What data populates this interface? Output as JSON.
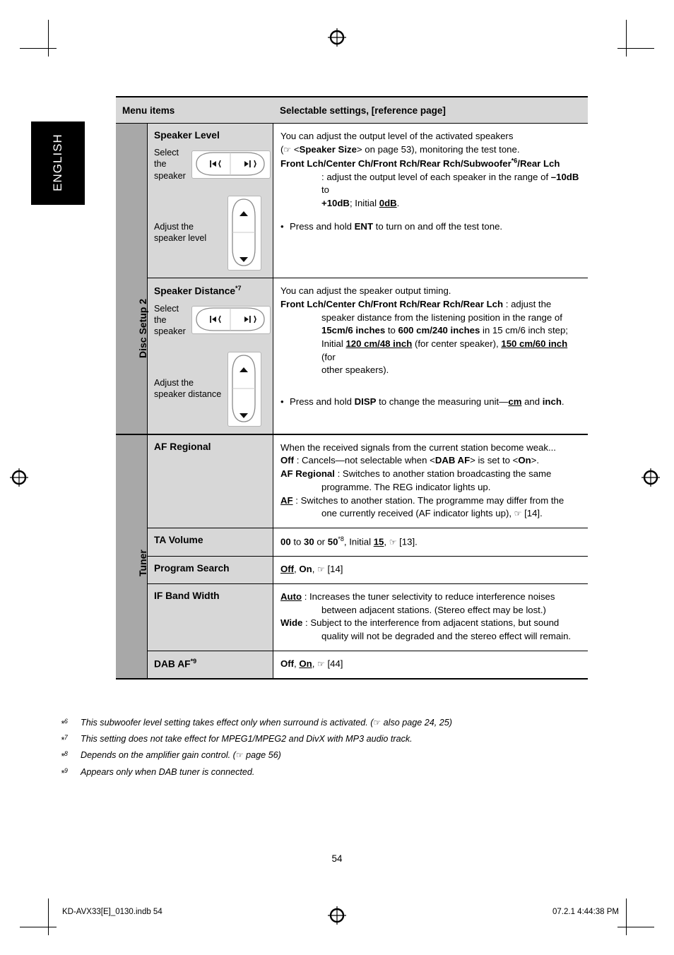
{
  "sidebar": {
    "language_tab": "ENGLISH"
  },
  "table": {
    "header": {
      "col1": "Menu items",
      "col2": "Selectable settings, [reference page]"
    },
    "sections": [
      {
        "label": "Disc Setup 2",
        "rows": [
          {
            "name": "Speaker Level",
            "controls": [
              {
                "label": "Select the speaker",
                "widget": "left-right-rocker-icon"
              },
              {
                "label": "Adjust the speaker level",
                "widget": "up-down-rocker-icon"
              }
            ],
            "lines": [
              "You can adjust the output level of the activated speakers",
              "(☞ <Speaker Size> on page 53), monitoring the test tone.",
              "Front Lch/Center Ch/Front Rch/Rear Rch/Subwoofer*6/Rear Lch",
              ": adjust the output level of each speaker in the range of –10dB to",
              "+10dB; Initial 0dB."
            ],
            "bullet": "Press and hold ENT to turn on and off the test tone."
          },
          {
            "name": "Speaker Distance*7",
            "controls": [
              {
                "label": "Select the speaker",
                "widget": "left-right-rocker-icon"
              },
              {
                "label": "Adjust the speaker distance",
                "widget": "up-down-rocker-icon"
              }
            ],
            "lines": [
              "You can adjust the speaker output timing.",
              "Front Lch/Center Ch/Front Rch/Rear Rch/Rear Lch : adjust the",
              "speaker distance from the listening position in the range of",
              "15cm/6 inches to 600 cm/240 inches in 15 cm/6 inch step;",
              "Initial 120 cm/48 inch (for center speaker), 150 cm/60 inch (for",
              "other speakers)."
            ],
            "bullet": "Press and hold DISP to change the measuring unit—cm and inch."
          }
        ]
      },
      {
        "label": "Tuner",
        "rows": [
          {
            "name": "AF Regional",
            "controls": [],
            "lines": [
              "When the received signals from the current station become weak...",
              "Off : Cancels—not selectable when <DAB AF> is set to <On>.",
              "AF Regional : Switches to another station broadcasting the same",
              "programme. The REG indicator lights up.",
              "AF : Switches to another station. The programme may differ from the",
              "one currently received (AF indicator lights up), ☞ [14]."
            ],
            "bullet": ""
          },
          {
            "name": "TA Volume",
            "controls": [],
            "lines": [
              "00 to 30 or 50*8, Initial 15, ☞ [13]."
            ],
            "bullet": ""
          },
          {
            "name": "Program Search",
            "controls": [],
            "lines": [
              "Off, On, ☞ [14]"
            ],
            "bullet": ""
          },
          {
            "name": "IF Band Width",
            "controls": [],
            "lines": [
              "Auto : Increases the tuner selectivity to reduce interference noises",
              "between adjacent stations. (Stereo effect may be lost.)",
              "Wide : Subject to the interference from adjacent stations, but sound",
              "quality will not be degraded and the stereo effect will remain."
            ],
            "bullet": ""
          },
          {
            "name": "DAB AF*9",
            "controls": [],
            "lines": [
              "Off, On, ☞ [44]"
            ],
            "bullet": ""
          }
        ]
      }
    ]
  },
  "footnotes": [
    {
      "marker": "*6",
      "text": "This subwoofer level setting takes effect only when surround is activated. (☞ also page 24, 25)"
    },
    {
      "marker": "*7",
      "text": "This setting does not take effect for MPEG1/MPEG2 and DivX with MP3 audio track."
    },
    {
      "marker": "*8",
      "text": "Depends on the amplifier gain control. (☞ page 56)"
    },
    {
      "marker": "*9",
      "text": "Appears only when DAB tuner is connected."
    }
  ],
  "page_number": "54",
  "footer": {
    "left": "KD-AVX33[E]_0130.indb   54",
    "right": "07.2.1   4:44:38 PM"
  }
}
